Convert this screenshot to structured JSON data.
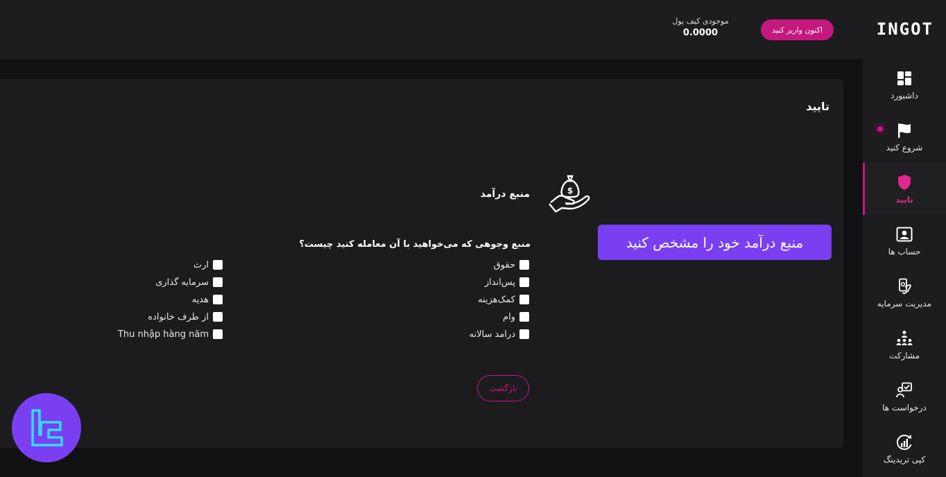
{
  "header": {
    "logo": "INGOT",
    "deposit_label": "اکنون واریز کنید",
    "wallet_label": "موجودی کیف پول",
    "wallet_value": "0.0000"
  },
  "sidebar": {
    "items": [
      {
        "label": "داشبورد",
        "icon": "dashboard-icon"
      },
      {
        "label": "شروع کنید",
        "icon": "flag-icon"
      },
      {
        "label": "تایید",
        "icon": "shield-icon",
        "active": true
      },
      {
        "label": "حساب ها",
        "icon": "account-card-icon"
      },
      {
        "label": "مدیریت سرمایه",
        "icon": "money-hand-icon"
      },
      {
        "label": "مشارکت",
        "icon": "network-icon"
      },
      {
        "label": "درخواست ها",
        "icon": "request-icon"
      },
      {
        "label": "کپی تریدینگ",
        "icon": "copy-trading-icon"
      }
    ]
  },
  "main": {
    "title": "تایید",
    "section_title": "منبع درآمد",
    "banner": "منبع درآمد خود را مشخص کنید",
    "question": "منبع وجوهی که می‌خواهید با آن معامله کنید چیست؟",
    "options_right": [
      "حقوق",
      "پس‌انداز",
      "کمک‌هزینه",
      "وام",
      "درامد سالانه"
    ],
    "options_left": [
      "ارث",
      "سرمایه گذاری",
      "هدیه",
      "از طرف خانواده",
      "Thu nhập hàng năm"
    ],
    "back_label": "بازگشت"
  },
  "colors": {
    "accent": "#c5187f",
    "banner": "#7b3ff2",
    "background": "#111113",
    "panel": "#1d1d20"
  }
}
